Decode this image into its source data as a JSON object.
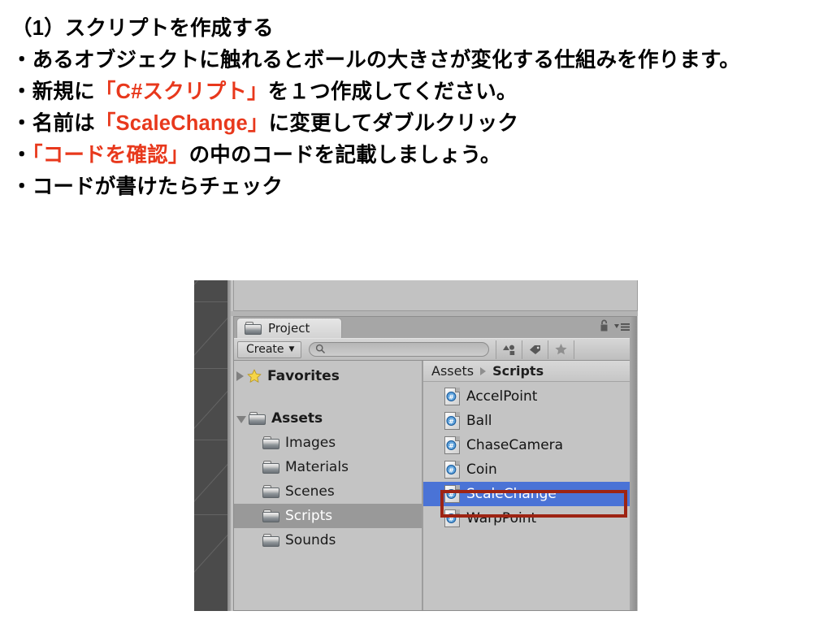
{
  "slide": {
    "lines": [
      {
        "segments": [
          {
            "text": "（1）スクリプトを作成する",
            "color": "black"
          }
        ]
      },
      {
        "segments": [
          {
            "text": "・あるオブジェクトに触れるとボールの大きさが変化する仕組みを作ります。",
            "color": "black"
          }
        ]
      },
      {
        "segments": [
          {
            "text": "・新規に",
            "color": "black"
          },
          {
            "text": "「C#スクリプト」",
            "color": "red"
          },
          {
            "text": "を１つ作成してください。",
            "color": "black"
          }
        ]
      },
      {
        "segments": [
          {
            "text": "・名前は",
            "color": "black"
          },
          {
            "text": "「ScaleChange」",
            "color": "red"
          },
          {
            "text": "に変更してダブルクリック",
            "color": "black"
          }
        ]
      },
      {
        "segments": [
          {
            "text": "・",
            "color": "black"
          },
          {
            "text": "「コードを確認」",
            "color": "red"
          },
          {
            "text": "の中のコードを記載しましょう。",
            "color": "black"
          }
        ]
      },
      {
        "segments": [
          {
            "text": "・コードが書けたらチェック",
            "color": "black"
          }
        ]
      }
    ],
    "line1": "（1）スクリプトを作成する",
    "line2": "・あるオブジェクトに触れるとボールの大きさが変化する仕組みを作ります。",
    "line3_a": "・新規に",
    "line3_b": "「C#スクリプト」",
    "line3_c": "を１つ作成してください。",
    "line4_a": "・名前は",
    "line4_b": "「ScaleChange」",
    "line4_c": "に変更してダブルクリック",
    "line5_a": "・",
    "line5_b": "「コードを確認」",
    "line5_c": "の中のコードを記載しましょう。",
    "line6": "・コードが書けたらチェック",
    "highlight_color": "#E8381C",
    "text_color": "#000000"
  },
  "unity": {
    "tab": {
      "label": "Project",
      "icon": "folder-icon",
      "lock_icon": "lock-icon",
      "menu_icon": "hamburger-menu-icon"
    },
    "toolbar": {
      "create_label": "Create",
      "create_caret": "▾",
      "search_value": "",
      "search_placeholder": "",
      "search_icon": "search-icon",
      "filter_buttons": [
        {
          "name": "type-filter-icon",
          "label": ""
        },
        {
          "name": "label-filter-icon",
          "label": ""
        },
        {
          "name": "favorites-filter-icon",
          "label": ""
        }
      ]
    },
    "tree": {
      "favorites": {
        "label": "Favorites",
        "expanded": false,
        "icon": "star-icon"
      },
      "root": {
        "label": "Assets",
        "expanded": true,
        "icon": "folder-icon"
      },
      "folders": [
        {
          "label": "Images",
          "selected": false
        },
        {
          "label": "Materials",
          "selected": false
        },
        {
          "label": "Scenes",
          "selected": false
        },
        {
          "label": "Scripts",
          "selected": true
        },
        {
          "label": "Sounds",
          "selected": false
        }
      ]
    },
    "breadcrumb": {
      "root": "Assets",
      "separator": "▸",
      "current": "Scripts"
    },
    "files": [
      {
        "name": "AccelPoint",
        "icon": "csharp-script-icon",
        "selected": false
      },
      {
        "name": "Ball",
        "icon": "csharp-script-icon",
        "selected": false
      },
      {
        "name": "ChaseCamera",
        "icon": "csharp-script-icon",
        "selected": false
      },
      {
        "name": "Coin",
        "icon": "csharp-script-icon",
        "selected": false
      },
      {
        "name": "ScaleChange",
        "icon": "csharp-script-icon",
        "selected": true
      },
      {
        "name": "WarpPoint",
        "icon": "csharp-script-icon",
        "selected": false
      }
    ],
    "colors": {
      "panel_bg": "#c4c4c4",
      "selection_blue": "#4a73d6",
      "tree_selection_gray": "#999999",
      "annotation_red": "#9e2413",
      "scene_dark": "#4b4b4b"
    }
  }
}
